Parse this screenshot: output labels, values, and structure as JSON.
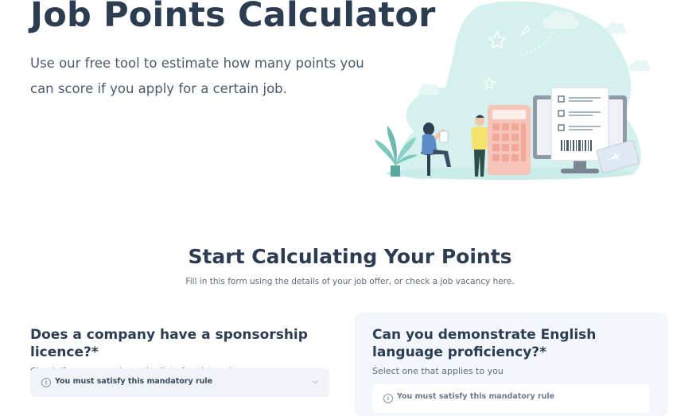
{
  "hero": {
    "title": "Job Points Calculator",
    "subtitle": "Use our free tool to estimate how many points you can score if you apply for a certain job."
  },
  "section": {
    "title": "Start Calculating Your Points",
    "subtitle": "Fill in this form using the details of your job offer, or check a job vacancy here."
  },
  "questions": [
    {
      "title": "Does a company have a sponsorship licence?*",
      "hint": "Check if a company is on the list of registered sponsors",
      "rule": "You must satisfy this mandatory rule"
    },
    {
      "title": "Can you demonstrate English language proficiency?*",
      "hint": "Select one that applies to you",
      "rule": "You must satisfy this mandatory rule"
    }
  ],
  "icons": {
    "info": "info-icon",
    "chevron": "chevron-down-icon"
  },
  "colors": {
    "heading": "#2c3d52",
    "blob": "#d4f1ee",
    "panel": "#f3f7fb"
  }
}
